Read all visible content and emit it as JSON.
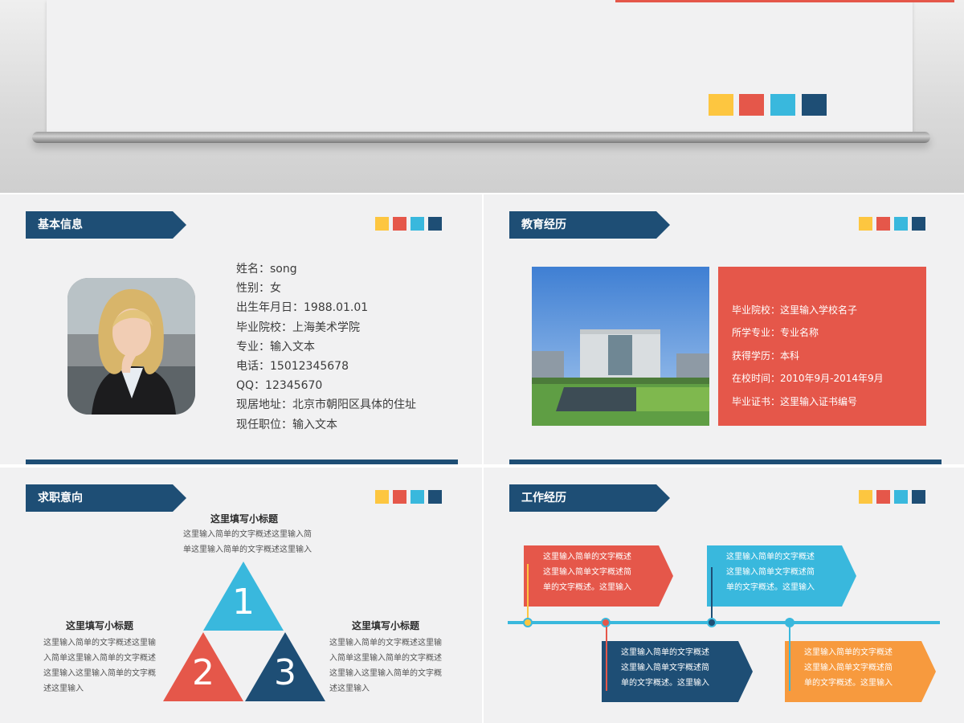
{
  "colors": {
    "navy": "#1e4e75",
    "red": "#e5574a",
    "blue": "#39b8dd",
    "yellow": "#fdc640",
    "orange": "#f79a3e",
    "panel": "#f1f1f2"
  },
  "basic_info": {
    "title": "基本信息",
    "photo_icon": "portrait-photo",
    "lines": [
      "姓名：song",
      "性别：女",
      "出生年月日：1988.01.01",
      "毕业院校：上海美术学院",
      "专业：输入文本",
      "电话：15012345678",
      "QQ：12345670",
      "现居地址：北京市朝阳区具体的住址",
      "现任职位：输入文本"
    ]
  },
  "education": {
    "title": "教育经历",
    "photo_icon": "campus-photo",
    "lines": [
      "毕业院校：这里输入学校名子",
      "所学专业：专业名称",
      "获得学历：本科",
      "在校时间：2010年9月-2014年9月",
      "毕业证书：这里输入证书编号"
    ]
  },
  "job_intent": {
    "title": "求职意向",
    "top": {
      "heading": "这里填写小标题",
      "text": [
        "这里输入简单的文字概述这里输入简",
        "单这里输入简单的文字概述这里输入"
      ]
    },
    "left": {
      "heading": "这里填写小标题",
      "text": [
        "这里输入简单的文字概述这里输",
        "入简单这里输入简单的文字概述",
        "这里输入这里输入简单的文字概",
        "述这里输入"
      ]
    },
    "right": {
      "heading": "这里填写小标题",
      "text": [
        "这里输入简单的文字概述这里输",
        "入简单这里输入简单的文字概述",
        "这里输入这里输入简单的文字概",
        "述这里输入"
      ]
    },
    "numbers": [
      "1",
      "2",
      "3"
    ]
  },
  "work": {
    "title": "工作经历",
    "items": [
      {
        "lines": [
          "这里输入简单的文字概述",
          "这里输入简单文字概述简",
          "单的文字概述。这里输入"
        ]
      },
      {
        "lines": [
          "这里输入简单的文字概述",
          "这里输入简单文字概述简",
          "单的文字概述。这里输入"
        ]
      },
      {
        "lines": [
          "这里输入简单的文字概述",
          "这里输入简单文字概述简",
          "单的文字概述。这里输入"
        ]
      },
      {
        "lines": [
          "这里输入简单的文字概述",
          "这里输入简单文字概述简",
          "单的文字概述。这里输入"
        ]
      }
    ]
  }
}
